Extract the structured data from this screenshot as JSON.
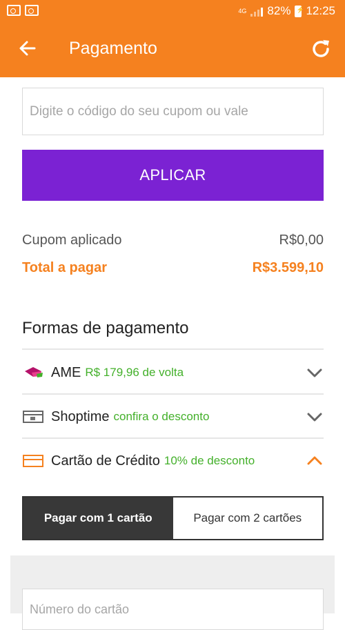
{
  "status_bar": {
    "network": "4G",
    "battery": "82%",
    "time": "12:25"
  },
  "header": {
    "title": "Pagamento",
    "back_icon": "arrow-left-icon",
    "refresh_icon": "refresh-icon"
  },
  "coupon": {
    "placeholder": "Digite o código do seu cupom ou vale",
    "apply_label": "APLICAR"
  },
  "summary": {
    "coupon_label": "Cupom aplicado",
    "coupon_value": "R$0,00",
    "total_label": "Total a pagar",
    "total_value": "R$3.599,10"
  },
  "payment": {
    "section_title": "Formas de pagamento",
    "methods": [
      {
        "name": "AME",
        "promo": "R$ 179,96 de volta",
        "icon": "ame-icon",
        "expanded": false
      },
      {
        "name": "Shoptime",
        "promo": "confira o desconto",
        "icon": "shoptime-card-icon",
        "expanded": false
      },
      {
        "name": "Cartão de Crédito",
        "promo": "10% de desconto",
        "icon": "credit-card-icon",
        "expanded": true
      }
    ]
  },
  "card_tabs": [
    {
      "label": "Pagar com 1 cartão",
      "active": true
    },
    {
      "label": "Pagar com 2 cartões",
      "active": false
    }
  ],
  "card_form": {
    "number_placeholder": "Número do cartão"
  },
  "colors": {
    "brand_orange": "#f5811f",
    "apply_purple": "#7b22d3",
    "promo_green": "#43b02a",
    "tab_active": "#383838"
  }
}
